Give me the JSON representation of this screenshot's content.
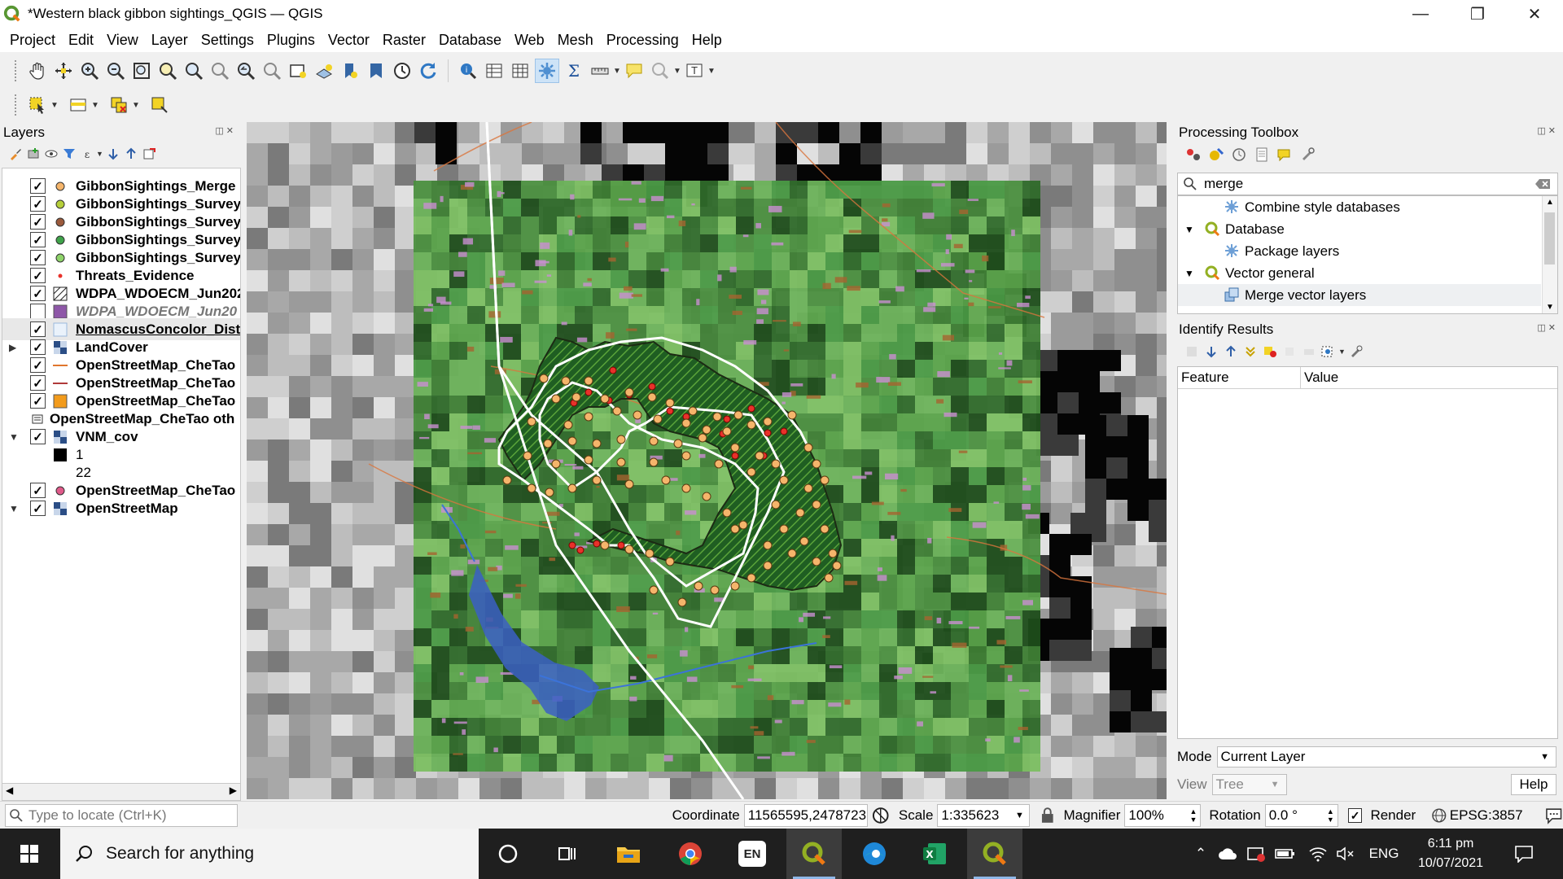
{
  "window": {
    "title": "*Western black gibbon sightings_QGIS — QGIS",
    "minimize": "—",
    "maximize": "❐",
    "close": "✕"
  },
  "menu": [
    "Project",
    "Edit",
    "View",
    "Layer",
    "Settings",
    "Plugins",
    "Vector",
    "Raster",
    "Database",
    "Web",
    "Mesh",
    "Processing",
    "Help"
  ],
  "layers_panel": {
    "title": "Layers",
    "items": [
      {
        "name": "GibbonSightings_Merge",
        "checked": "✓",
        "symbol": "orange-point",
        "expand": "",
        "indent": 0
      },
      {
        "name": "GibbonSightings_Survey",
        "checked": "✓",
        "symbol": "lime-point",
        "expand": "",
        "indent": 0
      },
      {
        "name": "GibbonSightings_Survey",
        "checked": "✓",
        "symbol": "brown-point",
        "expand": "",
        "indent": 0
      },
      {
        "name": "GibbonSightings_Survey",
        "checked": "✓",
        "symbol": "green-point",
        "expand": "",
        "indent": 0
      },
      {
        "name": "GibbonSightings_Survey",
        "checked": "✓",
        "symbol": "lightgreen-point",
        "expand": "",
        "indent": 0
      },
      {
        "name": "Threats_Evidence",
        "checked": "✓",
        "symbol": "red-star",
        "expand": "",
        "indent": 0
      },
      {
        "name": "WDPA_WDOECM_Jun202",
        "checked": "✓",
        "symbol": "hatch-polygon",
        "expand": "",
        "indent": 0
      },
      {
        "name": "WDPA_WDOECM_Jun20",
        "checked": "",
        "symbol": "purple-polygon",
        "expand": "",
        "indent": 0
      },
      {
        "name": "NomascusConcolor_Dist",
        "checked": "✓",
        "symbol": "outline-polygon",
        "expand": "",
        "indent": 0
      },
      {
        "name": "LandCover",
        "checked": "✓",
        "symbol": "raster",
        "expand": "▶",
        "indent": 0
      },
      {
        "name": "OpenStreetMap_CheTao",
        "checked": "✓",
        "symbol": "orange-line",
        "expand": "",
        "indent": 0
      },
      {
        "name": "OpenStreetMap_CheTao",
        "checked": "✓",
        "symbol": "red-line",
        "expand": "",
        "indent": 0
      },
      {
        "name": "OpenStreetMap_CheTao",
        "checked": "✓",
        "symbol": "orange-fill",
        "expand": "",
        "indent": 0
      },
      {
        "name": "OpenStreetMap_CheTao oth",
        "checked": "",
        "symbol": "group",
        "expand": "",
        "indent": 0
      },
      {
        "name": "VNM_cov",
        "checked": "✓",
        "symbol": "raster",
        "expand": "▼",
        "indent": 0
      },
      {
        "name": "1",
        "checked": "",
        "symbol": "black-box",
        "expand": "",
        "indent": 1
      },
      {
        "name": "22",
        "checked": "",
        "symbol": "",
        "expand": "",
        "indent": 1
      },
      {
        "name": "OpenStreetMap_CheTao",
        "checked": "✓",
        "symbol": "pink-point",
        "expand": "",
        "indent": 0
      },
      {
        "name": "OpenStreetMap",
        "checked": "✓",
        "symbol": "raster",
        "expand": "▼",
        "indent": 0
      }
    ]
  },
  "toolbox": {
    "title": "Processing Toolbox",
    "search_value": "merge",
    "tree": [
      {
        "label": "Combine style databases",
        "type": "algorithm",
        "level": 2,
        "expand": ""
      },
      {
        "label": "Database",
        "type": "provider",
        "level": 1,
        "expand": "▼"
      },
      {
        "label": "Package layers",
        "type": "algorithm",
        "level": 2,
        "expand": ""
      },
      {
        "label": "Vector general",
        "type": "provider",
        "level": 1,
        "expand": "▼"
      },
      {
        "label": "Merge vector layers",
        "type": "merge",
        "level": 2,
        "expand": ""
      }
    ]
  },
  "identify": {
    "title": "Identify Results",
    "col_feature": "Feature",
    "col_value": "Value",
    "mode_label": "Mode",
    "mode_value": "Current Layer",
    "view_label": "View",
    "view_value": "Tree",
    "help_label": "Help"
  },
  "statusbar": {
    "locate_placeholder": "Type to locate (Ctrl+K)",
    "coordinate_label": "Coordinate",
    "coordinate_value": "11565595,2478723",
    "scale_label": "Scale",
    "scale_value": "1:335623",
    "magnifier_label": "Magnifier",
    "magnifier_value": "100%",
    "rotation_label": "Rotation",
    "rotation_value": "0.0 °",
    "render_label": "Render",
    "crs": "EPSG:3857"
  },
  "taskbar": {
    "search_placeholder": "Search for anything",
    "lang": "ENG",
    "time": "6:11 pm",
    "date": "10/07/2021",
    "en_badge": "EN"
  },
  "colors": {
    "accent": "#0078d7",
    "qgis_green": "#589632",
    "sighting_point": "#f5b56b",
    "threat_point": "#e8312a"
  }
}
